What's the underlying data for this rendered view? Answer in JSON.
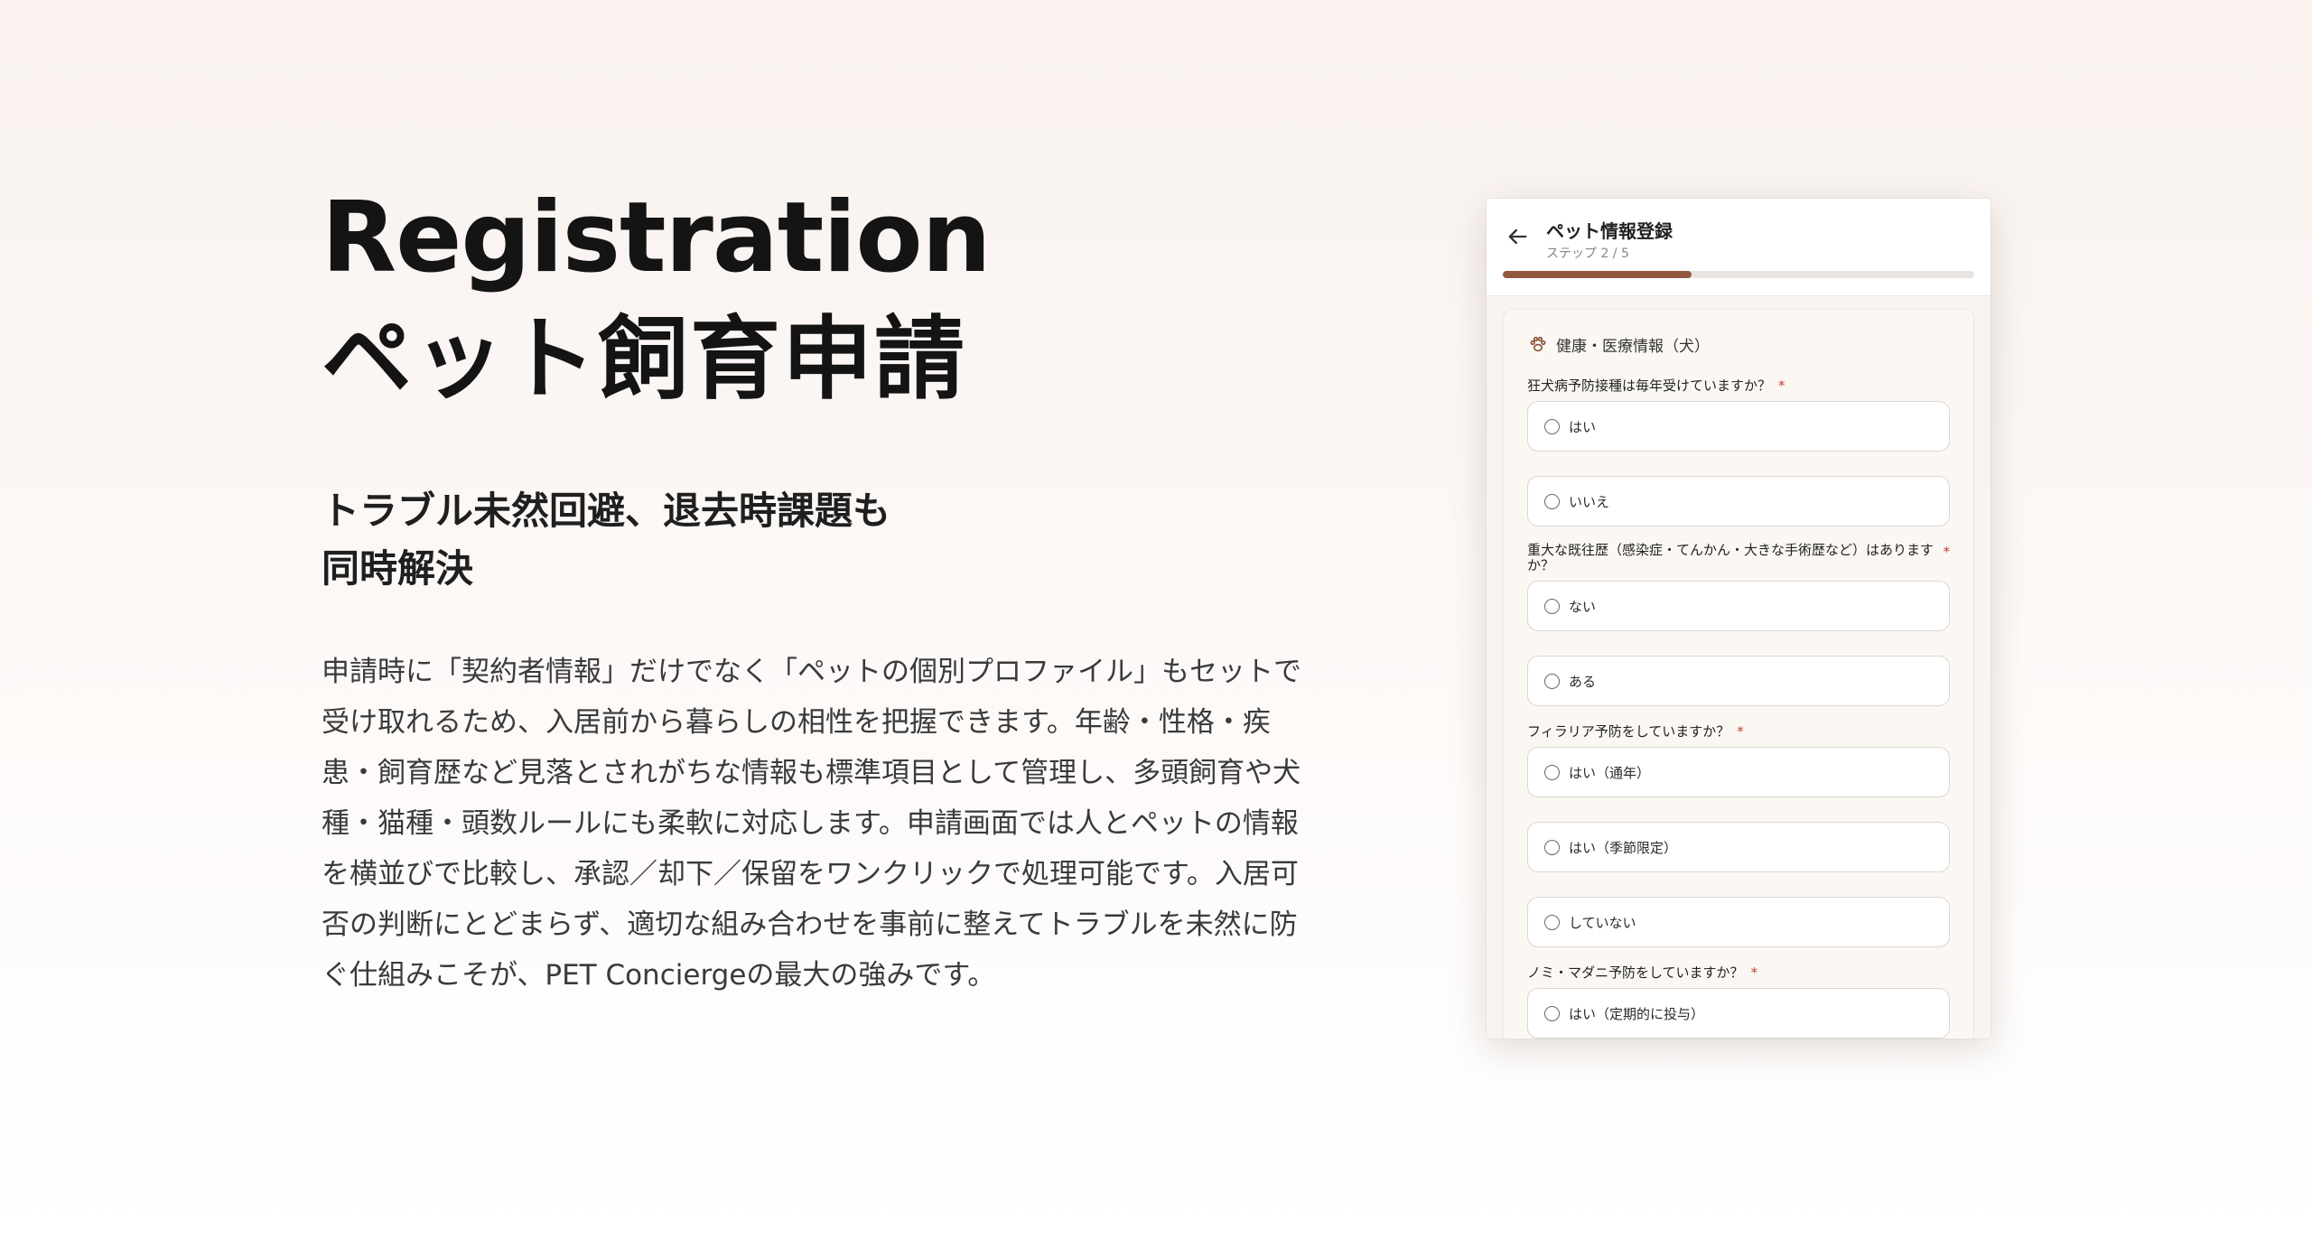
{
  "hero": {
    "title_en": "Registration",
    "title_ja": "ペット飼育申請",
    "subtitle": "トラブル未然回避、退去時課題も\n同時解決",
    "body": "申請時に「契約者情報」だけでなく「ペットの個別プロファイル」もセットで受け取れるため、入居前から暮らしの相性を把握できます。年齢・性格・疾患・飼育歴など見落とされがちな情報も標準項目として管理し、多頭飼育や犬種・猫種・頭数ルールにも柔軟に対応します。申請画面では人とペットの情報を横並びで比較し、承認／却下／保留をワンクリックで処理可能です。入居可否の判断にとどまらず、適切な組み合わせを事前に整えてトラブルを未然に防ぐ仕組みこそが、PET Conciergeの最大の強みです。"
  },
  "app": {
    "title": "ペット情報登録",
    "step": "ステップ 2 / 5",
    "progress": 0.4,
    "section_title": "健康・医療情報（犬）",
    "required_mark": "*",
    "questions": [
      {
        "label": "狂犬病予防接種は毎年受けていますか？",
        "options": [
          "はい",
          "いいえ"
        ]
      },
      {
        "label": "重大な既往歴（感染症・てんかん・大きな手術歴など）はありますか？",
        "options": [
          "ない",
          "ある"
        ]
      },
      {
        "label": "フィラリア予防をしていますか？",
        "options": [
          "はい（通年）",
          "はい（季節限定）",
          "していない"
        ]
      },
      {
        "label": "ノミ・マダニ予防をしていますか？",
        "options": [
          "はい（定期的に投与）"
        ]
      }
    ]
  },
  "colors": {
    "accent": "#93583d",
    "required": "#c2412d"
  },
  "icons": {
    "back": "arrow-left-icon",
    "section": "paw-icon"
  }
}
